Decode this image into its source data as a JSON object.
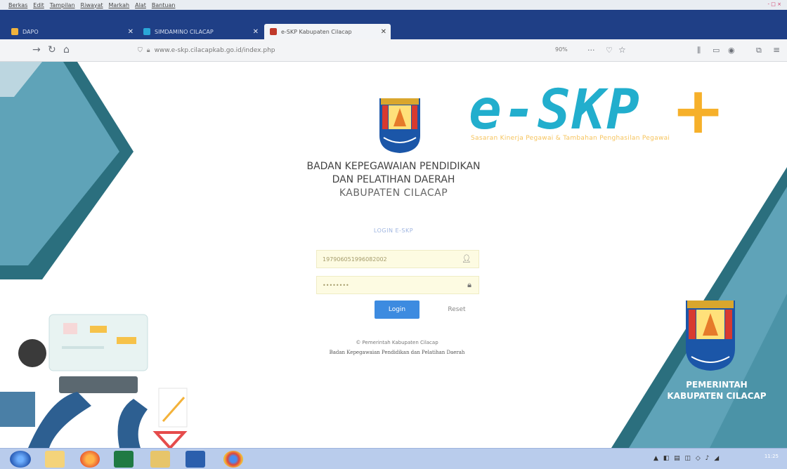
{
  "browser": {
    "menu": [
      "Berkas",
      "Edit",
      "Tampilan",
      "Riwayat",
      "Markah",
      "Alat",
      "Bantuan"
    ],
    "window_controls": "- □ ×",
    "tabs": [
      {
        "label": "DAPO",
        "active": false
      },
      {
        "label": "SIMDAMINO CILACAP",
        "active": false
      },
      {
        "label": "e-SKP Kabupaten Cilacap",
        "active": true
      }
    ],
    "address": {
      "url": "www.e-skp.cilacapkab.go.id/index.php",
      "zoom": "90%"
    }
  },
  "brand": {
    "title": "e-SKP",
    "plus": "+",
    "subtitle": "Sasaran Kinerja Pegawai & Tambahan Penghasilan Pegawai",
    "colors": {
      "title": "#22aecd",
      "plus": "#f6b02a",
      "panel_teal": "#2f7f8d",
      "login_button": "#3d8be0"
    }
  },
  "org": {
    "line1": "BADAN KEPEGAWAIAN PENDIDIKAN",
    "line2": "DAN PELATIHAN DAERAH",
    "line3": "KABUPATEN CILACAP"
  },
  "login": {
    "title": "LOGIN E-SKP",
    "username_value": "197906051996082002",
    "password_placeholder": "••••••••",
    "login_button": "Login",
    "reset_button": "Reset",
    "user_icon": "user-icon",
    "lock_icon": "lock-icon"
  },
  "footer": {
    "copyright": "© Pemerintah Kabupaten Cilacap",
    "agency": "Badan Kepegawaian Pendidikan dan Pelatihan Daerah"
  },
  "corner": {
    "crest_label": "CILACAP",
    "line1": "PEMERINTAH",
    "line2": "KABUPATEN CILACAP"
  },
  "taskbar": {
    "apps": [
      "start",
      "explorer",
      "firefox",
      "excel",
      "folder",
      "word",
      "chrome"
    ],
    "clock": "11:25"
  }
}
